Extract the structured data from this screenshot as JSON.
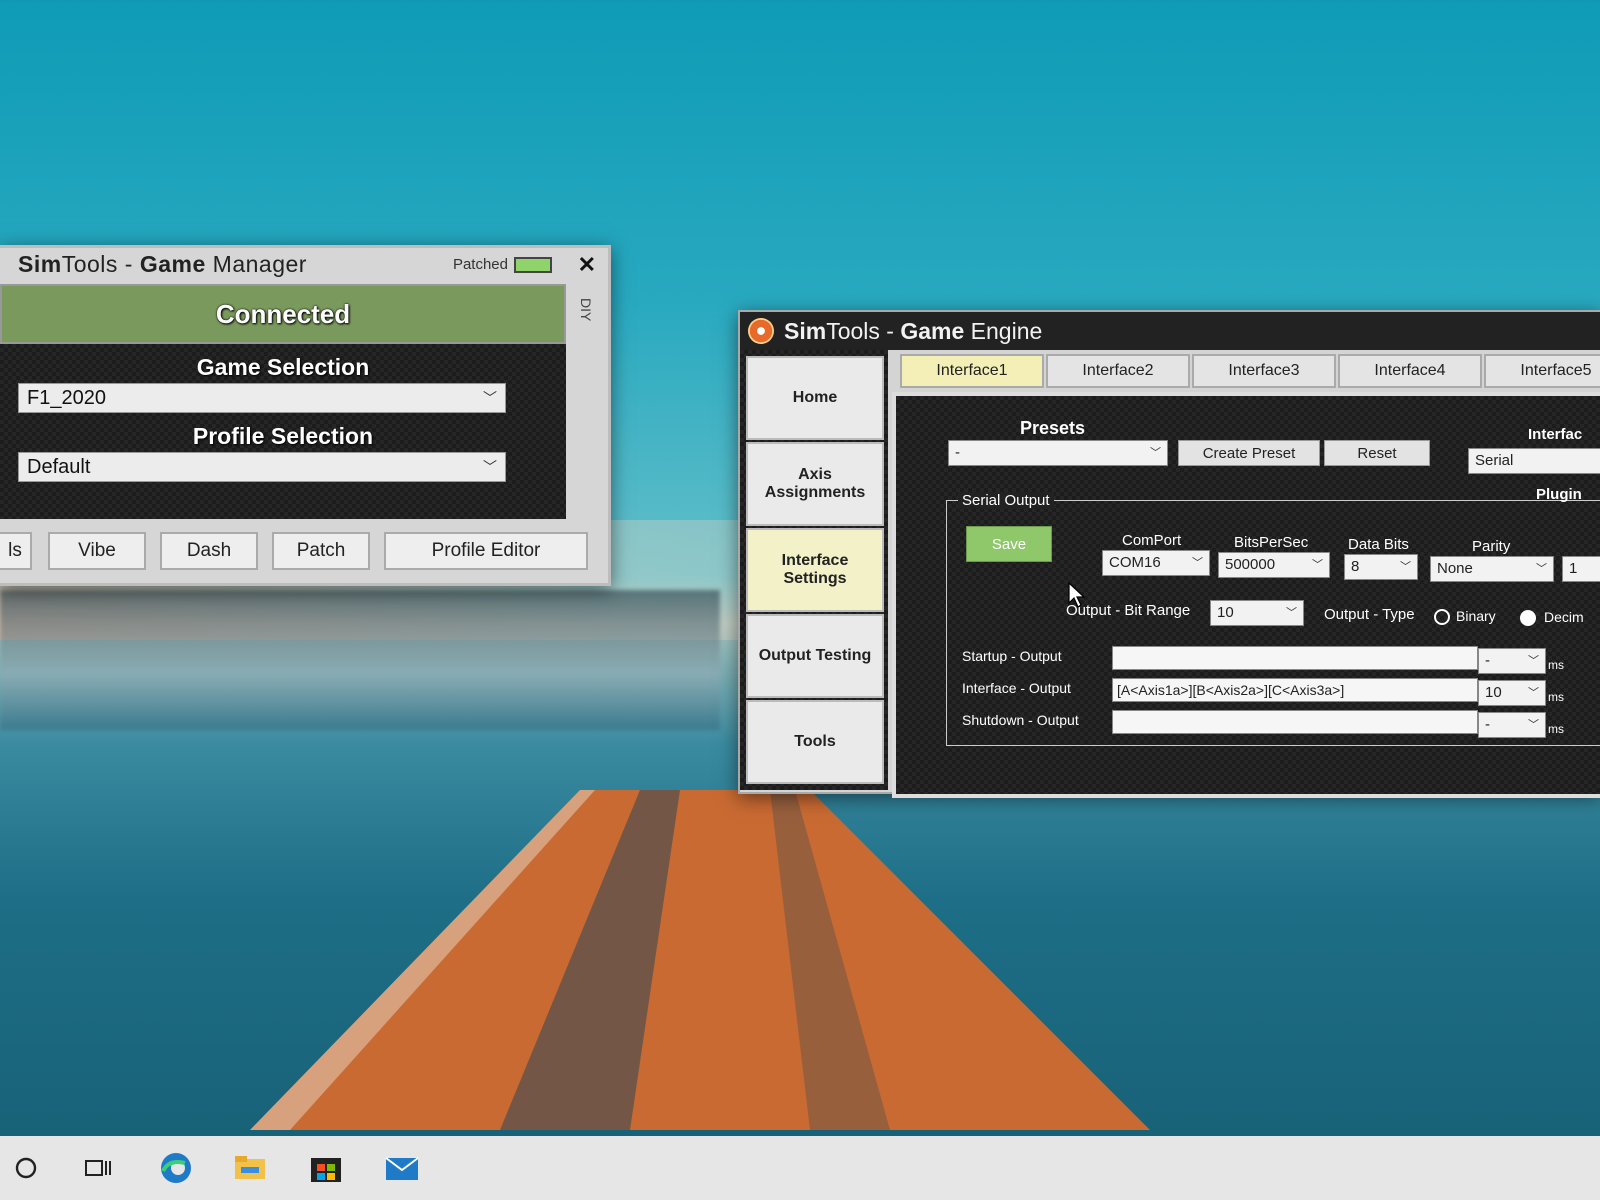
{
  "game_manager": {
    "title_light": "SimTools - ",
    "title_bold": "Game",
    "title_rest": " Manager",
    "title_prefix": "Sim",
    "title_prefix_rest": "Tools",
    "patched_label": "Patched",
    "diy_label": "DIY",
    "status": "Connected",
    "game_selection_label": "Game Selection",
    "game_selection_value": "F1_2020",
    "profile_selection_label": "Profile Selection",
    "profile_selection_value": "Default",
    "buttons": [
      "ls",
      "Vibe",
      "Dash",
      "Patch",
      "Profile Editor"
    ]
  },
  "game_engine": {
    "title_bold": "Sim",
    "title_a": "Tools - ",
    "title_b": "Game",
    "title_c": " Engine",
    "nav": [
      {
        "label": "Home"
      },
      {
        "label": "Axis Assignments"
      },
      {
        "label": "Interface Settings",
        "active": true
      },
      {
        "label": "Output Testing"
      },
      {
        "label": "Tools"
      }
    ],
    "tabs": [
      "Interface1",
      "Interface2",
      "Interface3",
      "Interface4",
      "Interface5"
    ],
    "presets_label": "Presets",
    "presets_value": "-",
    "create_preset": "Create Preset",
    "reset": "Reset",
    "interface_label": "Interfac",
    "interface_value": "Serial",
    "serial_output_label": "Serial Output",
    "plugin_label": "Plugin",
    "save": "Save",
    "comport_label": "ComPort",
    "comport_value": "COM16",
    "bitspersec_label": "BitsPerSec",
    "bitspersec_value": "500000",
    "databits_label": "Data Bits",
    "databits_value": "8",
    "parity_label": "Parity",
    "parity_value": "None",
    "stopbits_value": "1",
    "bit_range_label": "Output - Bit Range",
    "bit_range_value": "10",
    "output_type_label": "Output - Type",
    "binary_label": "Binary",
    "decimal_label": "Decim",
    "startup_label": "Startup - Output",
    "startup_value": "",
    "startup_ms": "-",
    "interface_output_label": "Interface - Output",
    "interface_output_value": "[A<Axis1a>][B<Axis2a>][C<Axis3a>]",
    "interface_ms": "10",
    "shutdown_label": "Shutdown - Output",
    "shutdown_value": "",
    "shutdown_ms": "-",
    "ms_unit": "ms"
  },
  "taskbar": {
    "icons": [
      "cortana-icon",
      "task-view-icon",
      "edge-icon",
      "file-explorer-icon",
      "store-icon",
      "mail-icon"
    ]
  }
}
